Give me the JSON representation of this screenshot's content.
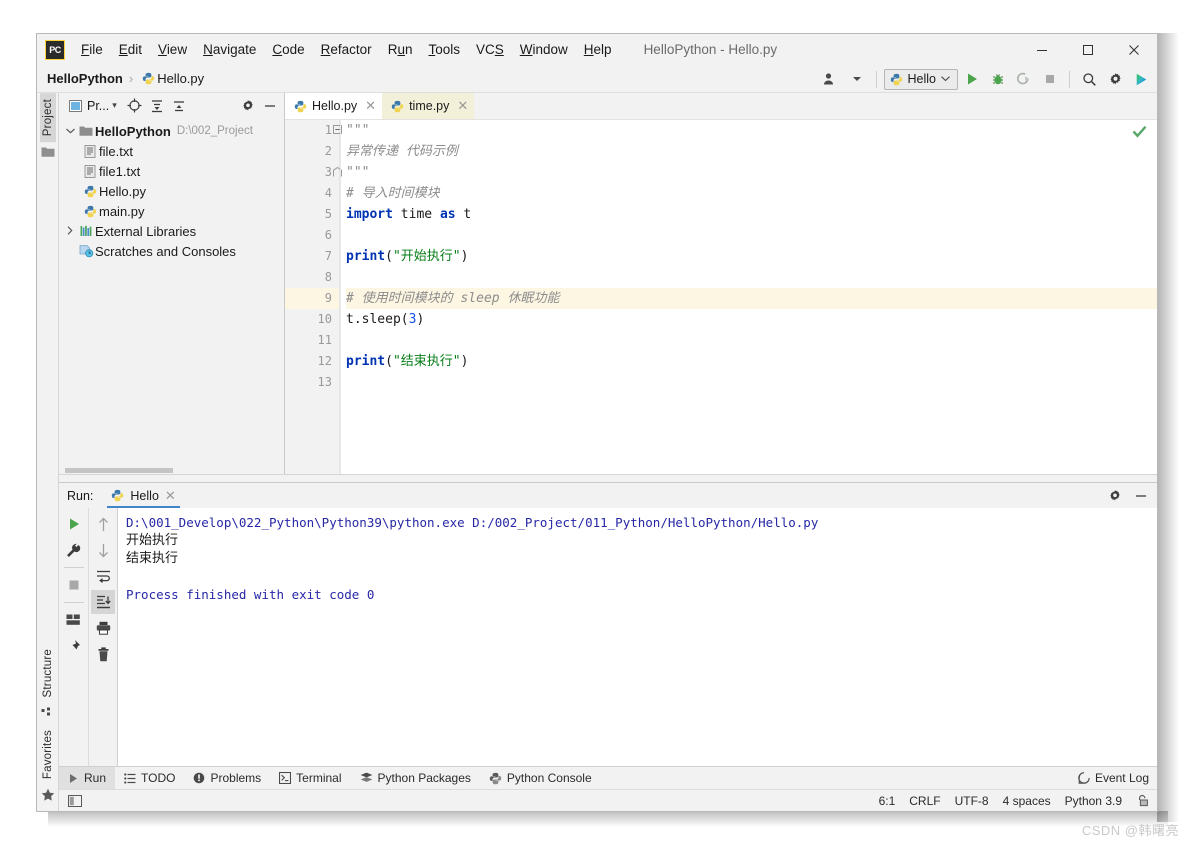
{
  "window": {
    "title": "HelloPython - Hello.py",
    "app_icon": "pycharm-icon",
    "controls": {
      "minimize": "–",
      "maximize": "□",
      "close": "✕"
    }
  },
  "menubar": {
    "items": [
      {
        "label": "File",
        "mnemonic": "F"
      },
      {
        "label": "Edit",
        "mnemonic": "E"
      },
      {
        "label": "View",
        "mnemonic": "V"
      },
      {
        "label": "Navigate",
        "mnemonic": "N"
      },
      {
        "label": "Code",
        "mnemonic": "C"
      },
      {
        "label": "Refactor",
        "mnemonic": "R"
      },
      {
        "label": "Run",
        "mnemonic": "R"
      },
      {
        "label": "Tools",
        "mnemonic": "T"
      },
      {
        "label": "VCS",
        "mnemonic": "S"
      },
      {
        "label": "Window",
        "mnemonic": "W"
      },
      {
        "label": "Help",
        "mnemonic": "H"
      }
    ]
  },
  "navbar": {
    "project": "HelloPython",
    "separator": "›",
    "file": "Hello.py",
    "file_icon": "python-file-icon"
  },
  "toolbar": {
    "user_icon": "user-account-icon",
    "dropdown_caret": "▾",
    "run_config": {
      "label": "Hello",
      "icon": "python-icon",
      "caret": "⌄"
    },
    "buttons": [
      {
        "name": "run-button",
        "icon": "play-icon"
      },
      {
        "name": "debug-button",
        "icon": "bug-icon"
      },
      {
        "name": "run-coverage-button",
        "icon": "coverage-icon"
      },
      {
        "name": "stop-button",
        "icon": "stop-icon"
      },
      {
        "name": "search-everywhere-button",
        "icon": "search-icon"
      },
      {
        "name": "settings-button",
        "icon": "gear-icon"
      },
      {
        "name": "datalore-button",
        "icon": "play-colored-icon"
      }
    ]
  },
  "left_strip": {
    "top": [
      {
        "label": "Project",
        "icon": "folder-icon",
        "selected": true
      }
    ],
    "bottom": [
      {
        "label": "Structure",
        "icon": "structure-icon",
        "selected": false
      },
      {
        "label": "Favorites",
        "icon": "star-icon",
        "selected": false
      }
    ],
    "layout_icon": "layout-icon"
  },
  "project_panel": {
    "title": "Pr...",
    "title_caret": "▾",
    "header_icons": [
      "target-icon",
      "expand-all-icon",
      "collapse-all-icon",
      "gear-icon",
      "hide-icon"
    ],
    "tree": [
      {
        "label": "HelloPython",
        "path": "D:\\002_Project",
        "icon": "folder-icon",
        "arrow": "⌄",
        "depth": 0,
        "bold": true
      },
      {
        "label": "file.txt",
        "icon": "text-file-icon",
        "arrow": "",
        "depth": 1,
        "bold": false
      },
      {
        "label": "file1.txt",
        "icon": "text-file-icon",
        "arrow": "",
        "depth": 1,
        "bold": false
      },
      {
        "label": "Hello.py",
        "icon": "python-file-icon",
        "arrow": "",
        "depth": 1,
        "bold": false
      },
      {
        "label": "main.py",
        "icon": "python-file-icon",
        "arrow": "",
        "depth": 1,
        "bold": false
      },
      {
        "label": "External Libraries",
        "icon": "libraries-icon",
        "arrow": "›",
        "depth": 0,
        "bold": false
      },
      {
        "label": "Scratches and Consoles",
        "icon": "scratches-icon",
        "arrow": "",
        "depth": 0,
        "bold": false
      }
    ]
  },
  "editor": {
    "tabs": [
      {
        "label": "Hello.py",
        "icon": "python-file-icon",
        "active": true,
        "close": "✕"
      },
      {
        "label": "time.py",
        "icon": "python-file-icon",
        "active": false,
        "close": "✕"
      }
    ],
    "inspection_status": "ok-check-icon",
    "lines": [
      {
        "n": 1,
        "tokens": [
          {
            "t": "\"\"\"",
            "c": "cmt"
          }
        ],
        "hl": false,
        "fold": "top"
      },
      {
        "n": 2,
        "tokens": [
          {
            "t": "异常传递 代码示例",
            "c": "cmt"
          }
        ],
        "hl": false,
        "fold": ""
      },
      {
        "n": 3,
        "tokens": [
          {
            "t": "\"\"\"",
            "c": "cmt"
          }
        ],
        "hl": false,
        "fold": "bot"
      },
      {
        "n": 4,
        "tokens": [
          {
            "t": "# 导入时间模块",
            "c": "cmt"
          }
        ],
        "hl": false,
        "fold": ""
      },
      {
        "n": 5,
        "tokens": [
          {
            "t": "import",
            "c": "kw"
          },
          {
            "t": " time ",
            "c": "fn"
          },
          {
            "t": "as",
            "c": "kw"
          },
          {
            "t": " t",
            "c": "fn"
          }
        ],
        "hl": false,
        "fold": ""
      },
      {
        "n": 6,
        "tokens": [],
        "hl": false,
        "fold": ""
      },
      {
        "n": 7,
        "tokens": [
          {
            "t": "print",
            "c": "kw"
          },
          {
            "t": "(",
            "c": "fn"
          },
          {
            "t": "\"开始执行\"",
            "c": "str"
          },
          {
            "t": ")",
            "c": "fn"
          }
        ],
        "hl": false,
        "fold": ""
      },
      {
        "n": 8,
        "tokens": [],
        "hl": false,
        "fold": ""
      },
      {
        "n": 9,
        "tokens": [
          {
            "t": "# 使用时间模块的 sleep 休眠功能",
            "c": "cmt"
          }
        ],
        "hl": true,
        "fold": ""
      },
      {
        "n": 10,
        "tokens": [
          {
            "t": "t.sleep(",
            "c": "fn"
          },
          {
            "t": "3",
            "c": "num"
          },
          {
            "t": ")",
            "c": "fn"
          }
        ],
        "hl": false,
        "fold": ""
      },
      {
        "n": 11,
        "tokens": [],
        "hl": false,
        "fold": ""
      },
      {
        "n": 12,
        "tokens": [
          {
            "t": "print",
            "c": "kw"
          },
          {
            "t": "(",
            "c": "fn"
          },
          {
            "t": "\"结束执行\"",
            "c": "str"
          },
          {
            "t": ")",
            "c": "fn"
          }
        ],
        "hl": false,
        "fold": ""
      },
      {
        "n": 13,
        "tokens": [],
        "hl": false,
        "fold": ""
      }
    ]
  },
  "run_panel": {
    "label": "Run:",
    "tab": {
      "label": "Hello",
      "icon": "python-icon",
      "close": "✕",
      "selected": true
    },
    "header_icons": [
      "gear-icon",
      "hide-icon"
    ],
    "left_tools": [
      {
        "name": "rerun-button",
        "icon": "play-icon"
      },
      {
        "name": "modify-run-config-button",
        "icon": "wrench-icon"
      },
      {
        "name": "stop-button",
        "icon": "stop-icon"
      },
      {
        "name": "layout-button",
        "icon": "layout-icon"
      },
      {
        "name": "pin-tab-button",
        "icon": "pin-icon"
      }
    ],
    "right_tools": [
      {
        "name": "up-button",
        "icon": "arrow-up-icon",
        "selected": false
      },
      {
        "name": "down-button",
        "icon": "arrow-down-icon",
        "selected": false
      },
      {
        "name": "soft-wrap-button",
        "icon": "soft-wrap-icon",
        "selected": false
      },
      {
        "name": "scroll-to-end-button",
        "icon": "scroll-end-icon",
        "selected": true
      },
      {
        "name": "print-button",
        "icon": "printer-icon",
        "selected": false
      },
      {
        "name": "clear-all-button",
        "icon": "trash-icon",
        "selected": false
      }
    ],
    "console": [
      {
        "text": "D:\\001_Develop\\022_Python\\Python39\\python.exe D:/002_Project/011_Python/HelloPython/Hello.py",
        "style": "blue"
      },
      {
        "text": "开始执行",
        "style": "black"
      },
      {
        "text": "结束执行",
        "style": "black"
      },
      {
        "text": "",
        "style": "black"
      },
      {
        "text": "Process finished with exit code 0",
        "style": "blue"
      }
    ]
  },
  "bottom_bar": {
    "items": [
      {
        "label": "Run",
        "icon": "play-icon",
        "selected": true
      },
      {
        "label": "TODO",
        "icon": "todo-icon",
        "selected": false
      },
      {
        "label": "Problems",
        "icon": "problems-icon",
        "selected": false
      },
      {
        "label": "Terminal",
        "icon": "terminal-icon",
        "selected": false
      },
      {
        "label": "Python Packages",
        "icon": "packages-icon",
        "selected": false
      },
      {
        "label": "Python Console",
        "icon": "python-console-icon",
        "selected": false
      }
    ],
    "event_log": {
      "label": "Event Log",
      "icon": "event-log-icon"
    }
  },
  "status_bar": {
    "left_icon": "layout-icon",
    "caret_position": "6:1",
    "line_separator": "CRLF",
    "encoding": "UTF-8",
    "indent": "4 spaces",
    "interpreter": "Python 3.9",
    "lock_icon": "unlocked-icon"
  },
  "watermark": "CSDN @韩曙亮",
  "colors": {
    "accent_blue": "#3e86c9",
    "keyword": "#0033b3",
    "string": "#067d17",
    "number": "#1750eb",
    "comment": "#8c8c8c",
    "console_blue": "#2727a8",
    "highlight_line": "#fdf6e3",
    "tab_inactive": "#f3f0da"
  }
}
